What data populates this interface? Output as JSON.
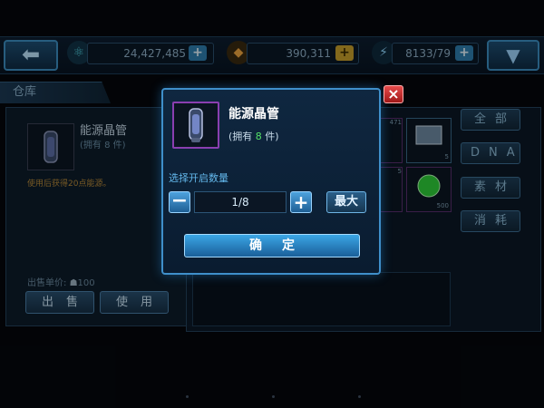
{
  "top_bar": {
    "energy_value": "24,427,485",
    "gem_value": "390,311",
    "stamina_value": "8133/79",
    "back_icon": "back-arrow-icon",
    "menu_icon": "chevron-down-icon"
  },
  "warehouse": {
    "title": "仓库",
    "item_name": "能源晶管",
    "own_text": "(拥有 8 件)",
    "description": "使用后获得20点能源。",
    "sell_price_label": "出售单价:",
    "sell_price_value": "100",
    "sell_button": "出售",
    "use_button": "使用"
  },
  "categories": [
    "全部",
    "DNA",
    "素材",
    "消耗"
  ],
  "grid": {
    "counts": [
      "471",
      "5",
      "5",
      "500"
    ]
  },
  "dialog": {
    "item_name": "能源晶管",
    "own_prefix": "(拥有 ",
    "own_count": "8",
    "own_suffix": " 件)",
    "select_label": "选择开启数量",
    "quantity": "1/8",
    "minus_label": "−",
    "plus_label": "+",
    "max_button": "最大",
    "confirm_button": "确定",
    "close_label": "×"
  },
  "colors": {
    "accent_blue": "#3f8fca",
    "count_green": "#54e067",
    "close_red": "#c82a2a",
    "rarity_purple": "#8a3fb0"
  }
}
